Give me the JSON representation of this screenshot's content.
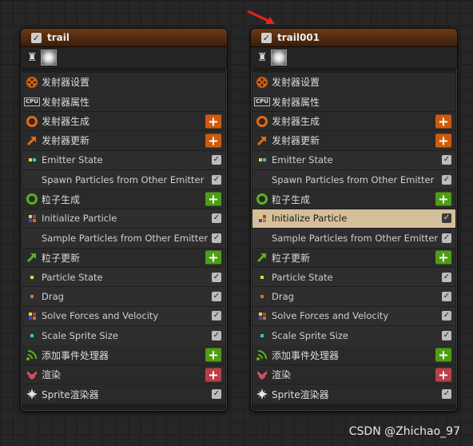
{
  "panels": [
    {
      "title": "trail",
      "rows": [
        {
          "label": "发射器设置",
          "icon": "emitter-settings-icon",
          "right": "none",
          "kind": "section"
        },
        {
          "label": "发射器属性",
          "icon": "cpu-icon",
          "right": "none",
          "kind": "section"
        },
        {
          "label": "发射器生成",
          "icon": "emitter-spawn-icon",
          "right": "add-orange",
          "kind": "section"
        },
        {
          "label": "发射器更新",
          "icon": "emitter-update-icon",
          "right": "add-orange",
          "kind": "section"
        },
        {
          "label": "Emitter State",
          "icon": "module-dots-icon",
          "right": "check",
          "kind": "module"
        },
        {
          "label": "Spawn Particles from Other Emitter",
          "icon": "none",
          "right": "check",
          "kind": "module"
        },
        {
          "label": "粒子生成",
          "icon": "particle-spawn-icon",
          "right": "add-green",
          "kind": "section"
        },
        {
          "label": "Initialize Particle",
          "icon": "module-grid-icon",
          "right": "check",
          "kind": "module"
        },
        {
          "label": "Sample Particles from Other Emitter",
          "icon": "none",
          "right": "check",
          "kind": "module"
        },
        {
          "label": "粒子更新",
          "icon": "particle-update-icon",
          "right": "add-green",
          "kind": "section"
        },
        {
          "label": "Particle State",
          "icon": "module-dot-yellow-icon",
          "right": "check",
          "kind": "module"
        },
        {
          "label": "Drag",
          "icon": "module-dot-orange-icon",
          "right": "check",
          "kind": "module"
        },
        {
          "label": "Solve Forces and Velocity",
          "icon": "module-grid-icon",
          "right": "check",
          "kind": "module"
        },
        {
          "label": "Scale Sprite Size",
          "icon": "module-dot-cyan-icon",
          "right": "check",
          "kind": "module"
        },
        {
          "label": "添加事件处理器",
          "icon": "event-handler-icon",
          "right": "add-green",
          "kind": "section"
        },
        {
          "label": "渲染",
          "icon": "render-icon",
          "right": "add-red",
          "kind": "section"
        },
        {
          "label": "Sprite渲染器",
          "icon": "sprite-renderer-icon",
          "right": "check",
          "kind": "section"
        }
      ]
    },
    {
      "title": "trail001",
      "rows": [
        {
          "label": "发射器设置",
          "icon": "emitter-settings-icon",
          "right": "none",
          "kind": "section"
        },
        {
          "label": "发射器属性",
          "icon": "cpu-icon",
          "right": "none",
          "kind": "section"
        },
        {
          "label": "发射器生成",
          "icon": "emitter-spawn-icon",
          "right": "add-orange",
          "kind": "section"
        },
        {
          "label": "发射器更新",
          "icon": "emitter-update-icon",
          "right": "add-orange",
          "kind": "section"
        },
        {
          "label": "Emitter State",
          "icon": "module-dots-icon",
          "right": "check",
          "kind": "module"
        },
        {
          "label": "Spawn Particles from Other Emitter",
          "icon": "none",
          "right": "check",
          "kind": "module"
        },
        {
          "label": "粒子生成",
          "icon": "particle-spawn-icon",
          "right": "add-green",
          "kind": "section"
        },
        {
          "label": "Initialize Particle",
          "icon": "module-grid-icon",
          "right": "check",
          "kind": "module",
          "selected": true
        },
        {
          "label": "Sample Particles from Other Emitter",
          "icon": "none",
          "right": "check",
          "kind": "module"
        },
        {
          "label": "粒子更新",
          "icon": "particle-update-icon",
          "right": "add-green",
          "kind": "section"
        },
        {
          "label": "Particle State",
          "icon": "module-dot-yellow-icon",
          "right": "check",
          "kind": "module"
        },
        {
          "label": "Drag",
          "icon": "module-dot-orange-icon",
          "right": "check",
          "kind": "module"
        },
        {
          "label": "Solve Forces and Velocity",
          "icon": "module-grid-icon",
          "right": "check",
          "kind": "module"
        },
        {
          "label": "Scale Sprite Size",
          "icon": "module-dot-cyan-icon",
          "right": "check",
          "kind": "module"
        },
        {
          "label": "添加事件处理器",
          "icon": "event-handler-icon",
          "right": "add-green",
          "kind": "section"
        },
        {
          "label": "渲染",
          "icon": "render-icon",
          "right": "add-red",
          "kind": "section"
        },
        {
          "label": "Sprite渲染器",
          "icon": "sprite-renderer-icon",
          "right": "check",
          "kind": "section"
        }
      ]
    }
  ],
  "watermark": "CSDN @Zhichao_97",
  "colors": {
    "add_orange": "#d05a0c",
    "add_green": "#4d9e16",
    "add_red": "#b84148",
    "selected_row": "#d5bf9a",
    "header": "#5a3010",
    "annotation_arrow": "#e8231a"
  }
}
